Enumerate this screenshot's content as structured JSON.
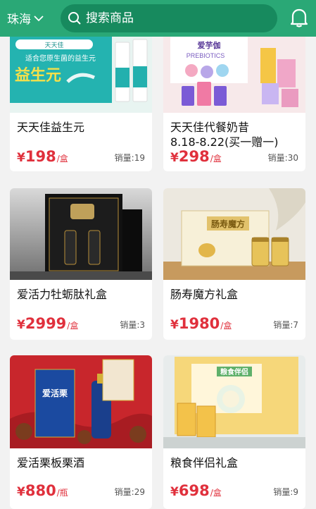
{
  "header": {
    "city": "珠海",
    "search_placeholder": "搜索商品"
  },
  "products": [
    {
      "name_lines": [
        "天天佳益生元"
      ],
      "currency": "¥",
      "price": "198",
      "unit": "/盒",
      "sales_label": "销量:",
      "sales": "19",
      "img_texts": [
        "益生元",
        "天天佳",
        "适合您原生菌的益生元"
      ]
    },
    {
      "name_lines": [
        "天天佳代餐奶昔",
        "8.18-8.22(买一赠一)"
      ],
      "currency": "¥",
      "price": "298",
      "unit": "/盒",
      "sales_label": "销量:",
      "sales": "30",
      "img_texts": [
        "爱芋伽",
        "PREBIOTICS"
      ]
    },
    {
      "name_lines": [
        "爱活力牡蛎肽礼盒"
      ],
      "currency": "¥",
      "price": "2999",
      "unit": "/盒",
      "sales_label": "销量:",
      "sales": "3",
      "img_texts": []
    },
    {
      "name_lines": [
        "肠寿魔方礼盒"
      ],
      "currency": "¥",
      "price": "1980",
      "unit": "/盒",
      "sales_label": "销量:",
      "sales": "7",
      "img_texts": [
        "肠寿魔方"
      ]
    },
    {
      "name_lines": [
        "爱活栗板栗酒"
      ],
      "currency": "¥",
      "price": "880",
      "unit": "/瓶",
      "sales_label": "销量:",
      "sales": "29",
      "img_texts": [
        "爱活栗"
      ]
    },
    {
      "name_lines": [
        "粮食伴侣礼盒"
      ],
      "currency": "¥",
      "price": "698",
      "unit": "/盒",
      "sales_label": "销量:",
      "sales": "9",
      "img_texts": [
        "粮食伴侣"
      ]
    }
  ],
  "colors": {
    "header": "#2aa876",
    "price": "#e0303c"
  },
  "icons": [
    "chevron-down-icon",
    "search-icon",
    "bell-icon"
  ]
}
